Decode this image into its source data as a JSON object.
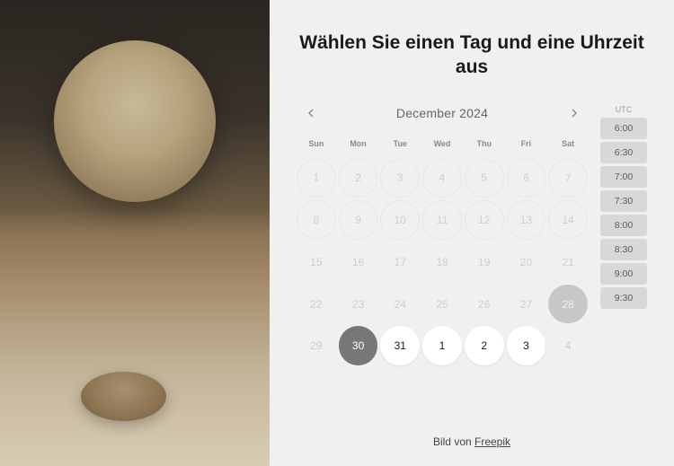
{
  "title": "Wählen Sie einen Tag und eine Uhrzeit aus",
  "month_label": "December  2024",
  "dow": [
    "Sun",
    "Mon",
    "Tue",
    "Wed",
    "Thu",
    "Fri",
    "Sat"
  ],
  "days": [
    {
      "n": "1",
      "cls": "past-ring"
    },
    {
      "n": "2",
      "cls": "past-ring"
    },
    {
      "n": "3",
      "cls": "past-ring"
    },
    {
      "n": "4",
      "cls": "past-ring"
    },
    {
      "n": "5",
      "cls": "past-ring"
    },
    {
      "n": "6",
      "cls": "past-ring"
    },
    {
      "n": "7",
      "cls": "past-ring"
    },
    {
      "n": "8",
      "cls": "past-ring"
    },
    {
      "n": "9",
      "cls": "past-ring"
    },
    {
      "n": "10",
      "cls": "past-ring"
    },
    {
      "n": "11",
      "cls": "past-ring"
    },
    {
      "n": "12",
      "cls": "past-ring"
    },
    {
      "n": "13",
      "cls": "past-ring"
    },
    {
      "n": "14",
      "cls": "past-ring"
    },
    {
      "n": "15",
      "cls": ""
    },
    {
      "n": "16",
      "cls": ""
    },
    {
      "n": "17",
      "cls": ""
    },
    {
      "n": "18",
      "cls": ""
    },
    {
      "n": "19",
      "cls": ""
    },
    {
      "n": "20",
      "cls": ""
    },
    {
      "n": "21",
      "cls": ""
    },
    {
      "n": "22",
      "cls": ""
    },
    {
      "n": "23",
      "cls": ""
    },
    {
      "n": "24",
      "cls": ""
    },
    {
      "n": "25",
      "cls": ""
    },
    {
      "n": "26",
      "cls": ""
    },
    {
      "n": "27",
      "cls": ""
    },
    {
      "n": "28",
      "cls": "highlight-disabled"
    },
    {
      "n": "29",
      "cls": ""
    },
    {
      "n": "30",
      "cls": "current"
    },
    {
      "n": "31",
      "cls": "available"
    },
    {
      "n": "1",
      "cls": "available"
    },
    {
      "n": "2",
      "cls": "available"
    },
    {
      "n": "3",
      "cls": "available"
    },
    {
      "n": "4",
      "cls": ""
    }
  ],
  "tz": "UTC",
  "times": [
    "6:00",
    "6:30",
    "7:00",
    "7:30",
    "8:00",
    "8:30",
    "9:00",
    "9:30"
  ],
  "credit_prefix": "Bild von ",
  "credit_link": "Freepik"
}
